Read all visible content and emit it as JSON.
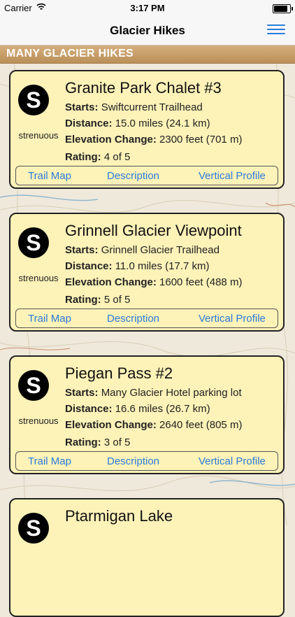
{
  "status_bar": {
    "carrier": "Carrier",
    "time": "3:17 PM",
    "battery_level": 0.95
  },
  "nav": {
    "title": "Glacier Hikes",
    "menu_icon": "hamburger-icon"
  },
  "section": {
    "label": "MANY GLACIER HIKES"
  },
  "labels": {
    "starts": "Starts:",
    "distance": "Distance:",
    "elevation": "Elevation Change:",
    "rating": "Rating:"
  },
  "actions": {
    "trail_map": "Trail Map",
    "description": "Description",
    "vertical_profile": "Vertical Profile"
  },
  "hikes": [
    {
      "badge": "S",
      "difficulty": "strenuous",
      "name": "Granite Park Chalet #3",
      "starts": "Swiftcurrent Trailhead",
      "distance": "15.0 miles (24.1 km)",
      "elevation": "2300 feet (701 m)",
      "rating": "4 of 5"
    },
    {
      "badge": "S",
      "difficulty": "strenuous",
      "name": "Grinnell Glacier Viewpoint",
      "starts": "Grinnell Glacier Trailhead",
      "distance": "11.0 miles (17.7 km)",
      "elevation": "1600 feet (488 m)",
      "rating": "5 of 5"
    },
    {
      "badge": "S",
      "difficulty": "strenuous",
      "name": "Piegan Pass #2",
      "starts": "Many Glacier Hotel parking lot",
      "distance": "16.6 miles (26.7 km)",
      "elevation": "2640 feet (805 m)",
      "rating": "3 of 5"
    },
    {
      "badge": "S",
      "name": "Ptarmigan Lake"
    }
  ]
}
